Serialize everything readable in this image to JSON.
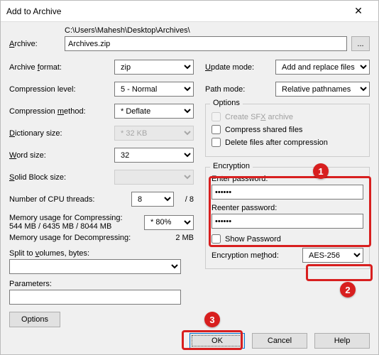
{
  "window": {
    "title": "Add to Archive",
    "close": "✕"
  },
  "archive": {
    "label": "Archive:",
    "path": "C:\\Users\\Mahesh\\Desktop\\Archives\\",
    "filename": "Archives.zip",
    "browse": "..."
  },
  "left": {
    "format": {
      "label": "Archive format:",
      "value": "zip"
    },
    "level": {
      "label": "Compression level:",
      "value": "5 - Normal"
    },
    "method": {
      "label": "Compression method:",
      "value": "* Deflate"
    },
    "dict": {
      "label": "Dictionary size:",
      "value": "* 32 KB"
    },
    "word": {
      "label": "Word size:",
      "value": "32"
    },
    "block": {
      "label": "Solid Block size:",
      "value": ""
    },
    "threads": {
      "label": "Number of CPU threads:",
      "value": "8",
      "suffix": "/ 8"
    },
    "mem_comp": {
      "label": "Memory usage for Compressing:",
      "detail": "544 MB / 6435 MB / 8044 MB",
      "value": "* 80%"
    },
    "mem_decomp": {
      "label": "Memory usage for Decompressing:",
      "value": "2 MB"
    },
    "split": {
      "label": "Split to volumes, bytes:",
      "value": ""
    },
    "params": {
      "label": "Parameters:",
      "value": ""
    },
    "options_btn": "Options"
  },
  "right": {
    "update": {
      "label": "Update mode:",
      "value": "Add and replace files"
    },
    "pathmode": {
      "label": "Path mode:",
      "value": "Relative pathnames"
    },
    "options": {
      "title": "Options",
      "sfx": "Create SFX archive",
      "shared": "Compress shared files",
      "del": "Delete files after compression"
    },
    "enc": {
      "title": "Encryption",
      "enter": "Enter password:",
      "reenter": "Reenter password:",
      "pw": "******",
      "show": "Show Password",
      "method_label": "Encryption method:",
      "method_value": "AES-256"
    }
  },
  "footer": {
    "ok": "OK",
    "cancel": "Cancel",
    "help": "Help"
  },
  "badges": {
    "b1": "1",
    "b2": "2",
    "b3": "3"
  }
}
